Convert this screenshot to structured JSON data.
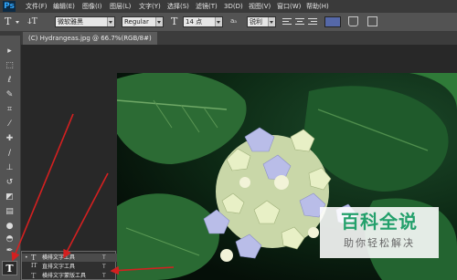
{
  "menubar": {
    "logo": "Ps",
    "items": [
      "文件(F)",
      "编辑(E)",
      "图像(I)",
      "图层(L)",
      "文字(Y)",
      "选择(S)",
      "滤镜(T)",
      "3D(D)",
      "视图(V)",
      "窗口(W)",
      "帮助(H)"
    ]
  },
  "optionsbar": {
    "tool_glyph": "T",
    "orient_glyph": "ↆT",
    "font_family": "微软雅黑",
    "font_style": "Regular",
    "size_glyph": "T",
    "font_size": "14 点",
    "aa_label": "aₐ",
    "aa_method": "锐利",
    "text_color": "#5568a8"
  },
  "document": {
    "tab_title": "(C) Hydrangeas.jpg @ 66.7%(RGB/8#)"
  },
  "toolbar": {
    "tools": [
      {
        "name": "move-tool-icon",
        "glyph": "▸"
      },
      {
        "name": "marquee-tool-icon",
        "glyph": "⬚"
      },
      {
        "name": "lasso-tool-icon",
        "glyph": "ℓ"
      },
      {
        "name": "quick-select-tool-icon",
        "glyph": "✎"
      },
      {
        "name": "crop-tool-icon",
        "glyph": "⌗"
      },
      {
        "name": "eyedropper-tool-icon",
        "glyph": "⁄"
      },
      {
        "name": "healing-brush-tool-icon",
        "glyph": "✚"
      },
      {
        "name": "brush-tool-icon",
        "glyph": "∕"
      },
      {
        "name": "clone-stamp-tool-icon",
        "glyph": "⊥"
      },
      {
        "name": "history-brush-tool-icon",
        "glyph": "↺"
      },
      {
        "name": "eraser-tool-icon",
        "glyph": "◩"
      },
      {
        "name": "gradient-tool-icon",
        "glyph": "▤"
      },
      {
        "name": "blur-tool-icon",
        "glyph": "●"
      },
      {
        "name": "dodge-tool-icon",
        "glyph": "◓"
      },
      {
        "name": "pen-tool-icon",
        "glyph": "✒"
      }
    ],
    "type_tool": "T"
  },
  "flyout": {
    "items": [
      {
        "bullet": "•",
        "icon": "T",
        "label": "横排文字工具",
        "key": "T"
      },
      {
        "bullet": "",
        "icon": "IT",
        "label": "直排文字工具",
        "key": "T"
      },
      {
        "bullet": "",
        "icon": "T",
        "label": "横排文字蒙版工具",
        "key": "T"
      }
    ]
  },
  "watermark": {
    "title": "百科全说",
    "subtitle": "助你轻松解决"
  },
  "colors": {
    "annotation_arrow": "#d42020",
    "watermark_green": "#23a06b"
  }
}
